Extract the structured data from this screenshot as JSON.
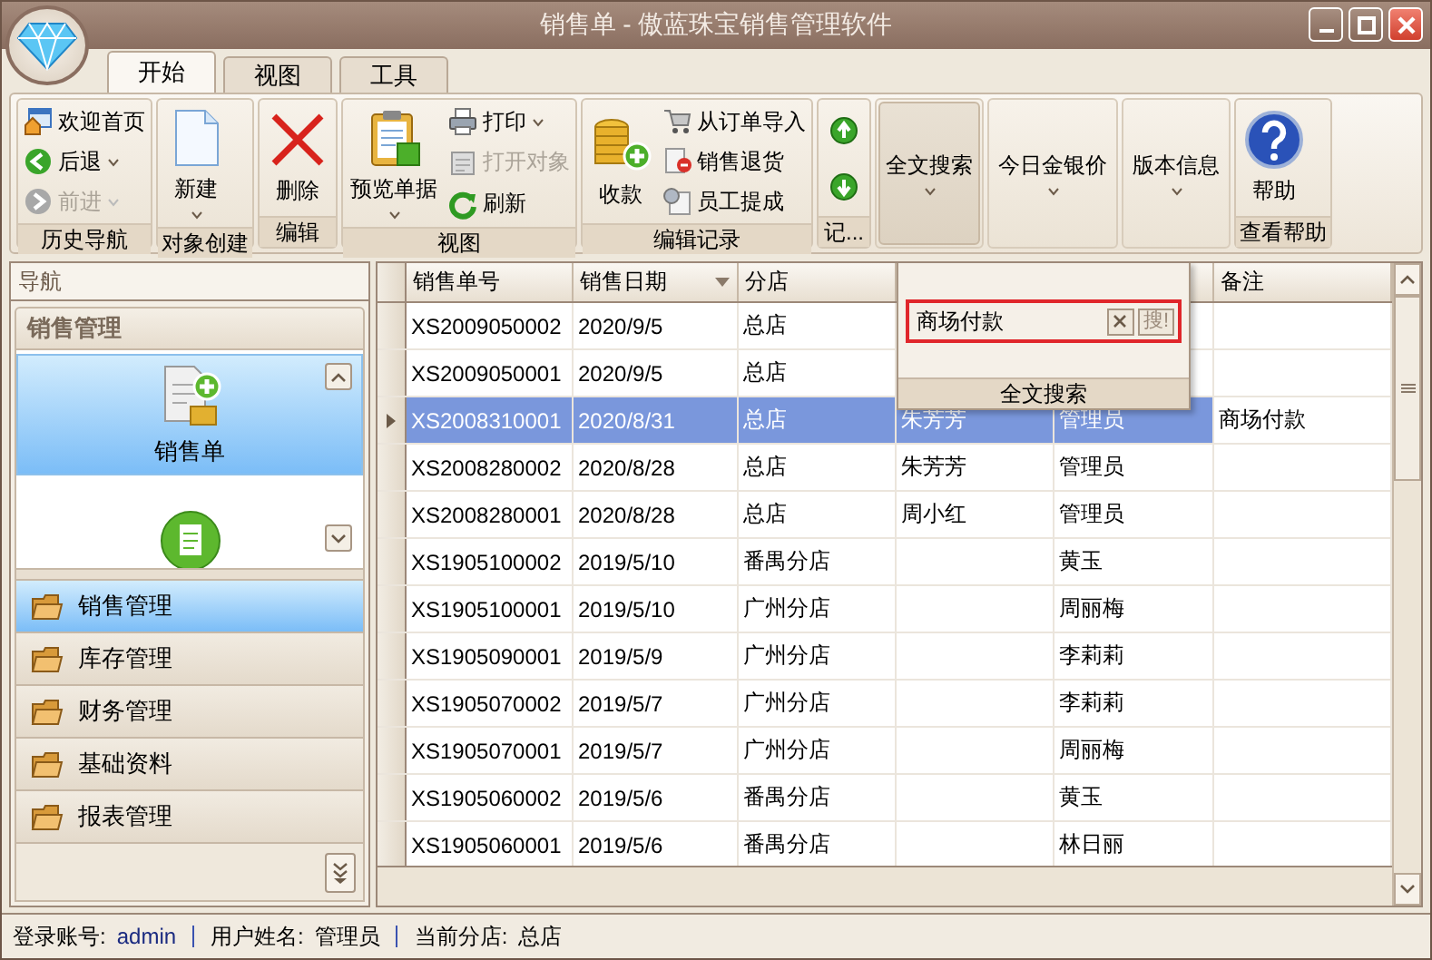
{
  "window": {
    "title": "销售单 - 傲蓝珠宝销售管理软件"
  },
  "tabs": [
    {
      "label": "开始",
      "selected": true
    },
    {
      "label": "视图",
      "selected": false
    },
    {
      "label": "工具",
      "selected": false
    }
  ],
  "ribbon": {
    "groups": [
      {
        "title": "历史导航",
        "items": [
          {
            "kind": "small",
            "label": "欢迎首页",
            "disabled": false,
            "dropdown": false
          },
          {
            "kind": "small",
            "label": "后退",
            "disabled": false,
            "dropdown": true
          },
          {
            "kind": "small",
            "label": "前进",
            "disabled": true,
            "dropdown": true
          }
        ]
      },
      {
        "title": "对象创建",
        "items": [
          {
            "kind": "large",
            "label": "新建",
            "dropdown": true,
            "pressed": false
          }
        ]
      },
      {
        "title": "编辑",
        "items": [
          {
            "kind": "large",
            "label": "删除",
            "dropdown": false,
            "pressed": false
          }
        ]
      },
      {
        "title": "视图",
        "items": [
          {
            "kind": "large",
            "label": "预览单据",
            "dropdown": true,
            "pressed": false
          },
          {
            "kind": "small",
            "label": "打印",
            "disabled": false,
            "dropdown": true
          },
          {
            "kind": "small",
            "label": "打开对象",
            "disabled": true,
            "dropdown": false
          },
          {
            "kind": "small",
            "label": "刷新",
            "disabled": false,
            "dropdown": false
          }
        ]
      },
      {
        "title": "编辑记录",
        "items": [
          {
            "kind": "large",
            "label": "收款",
            "dropdown": false,
            "pressed": false
          },
          {
            "kind": "small",
            "label": "从订单导入",
            "disabled": false,
            "dropdown": false
          },
          {
            "kind": "small",
            "label": "销售退货",
            "disabled": false,
            "dropdown": false
          },
          {
            "kind": "small",
            "label": "员工提成",
            "disabled": false,
            "dropdown": false
          }
        ]
      },
      {
        "title": "记...",
        "items": [
          {
            "kind": "icon"
          },
          {
            "kind": "icon"
          }
        ]
      },
      {
        "items": [
          {
            "kind": "large",
            "label": "全文搜索",
            "dropdown": true,
            "pressed": true
          }
        ]
      },
      {
        "items": [
          {
            "kind": "large",
            "label": "今日金银价",
            "dropdown": true,
            "pressed": false
          }
        ]
      },
      {
        "items": [
          {
            "kind": "large",
            "label": "版本信息",
            "dropdown": true,
            "pressed": false
          }
        ]
      },
      {
        "title": "查看帮助",
        "items": [
          {
            "kind": "large",
            "label": "帮助",
            "dropdown": false,
            "pressed": false
          }
        ]
      }
    ]
  },
  "navigation": {
    "title": "导航",
    "section": "销售管理",
    "tiles": [
      {
        "label": "销售单",
        "selected": true
      },
      {
        "selected": false
      }
    ],
    "categories": [
      {
        "label": "销售管理",
        "selected": true
      },
      {
        "label": "库存管理",
        "selected": false
      },
      {
        "label": "财务管理",
        "selected": false
      },
      {
        "label": "基础资料",
        "selected": false
      },
      {
        "label": "报表管理",
        "selected": false
      }
    ]
  },
  "table": {
    "columns": [
      {
        "label": "销售单号",
        "sorted": false
      },
      {
        "label": "销售日期",
        "sorted": true
      },
      {
        "label": "分店",
        "sorted": false
      },
      null,
      null,
      {
        "label": "备注",
        "sorted": false
      }
    ],
    "rows": [
      {
        "selected": false,
        "cells": [
          "XS2009050002",
          "2020/9/5",
          "总店",
          "",
          "",
          ""
        ]
      },
      {
        "selected": false,
        "cells": [
          "XS2009050001",
          "2020/9/5",
          "总店",
          "",
          "",
          ""
        ]
      },
      {
        "selected": true,
        "cells": [
          "XS2008310001",
          "2020/8/31",
          "总店",
          "朱芳芳",
          "管理员",
          "商场付款"
        ]
      },
      {
        "selected": false,
        "cells": [
          "XS2008280002",
          "2020/8/28",
          "总店",
          "朱芳芳",
          "管理员",
          ""
        ]
      },
      {
        "selected": false,
        "cells": [
          "XS2008280001",
          "2020/8/28",
          "总店",
          "周小红",
          "管理员",
          ""
        ]
      },
      {
        "selected": false,
        "cells": [
          "XS1905100002",
          "2019/5/10",
          "番禺分店",
          "",
          "黄玉",
          ""
        ]
      },
      {
        "selected": false,
        "cells": [
          "XS1905100001",
          "2019/5/10",
          "广州分店",
          "",
          "周丽梅",
          ""
        ]
      },
      {
        "selected": false,
        "cells": [
          "XS1905090001",
          "2019/5/9",
          "广州分店",
          "",
          "李莉莉",
          ""
        ]
      },
      {
        "selected": false,
        "cells": [
          "XS1905070002",
          "2019/5/7",
          "广州分店",
          "",
          "李莉莉",
          ""
        ]
      },
      {
        "selected": false,
        "cells": [
          "XS1905070001",
          "2019/5/7",
          "广州分店",
          "",
          "周丽梅",
          ""
        ]
      },
      {
        "selected": false,
        "cells": [
          "XS1905060002",
          "2019/5/6",
          "番禺分店",
          "",
          "黄玉",
          ""
        ]
      },
      {
        "selected": false,
        "cells": [
          "XS1905060001",
          "2019/5/6",
          "番禺分店",
          "",
          "林日丽",
          ""
        ]
      }
    ]
  },
  "search_popup": {
    "value": "商场付款",
    "search_button": "搜!",
    "title": "全文搜索"
  },
  "status_bar": {
    "login_label": "登录账号:",
    "login": "admin",
    "user_label": "用户姓名:",
    "user": "管理员",
    "branch_label": "当前分店:",
    "branch": "总店"
  }
}
